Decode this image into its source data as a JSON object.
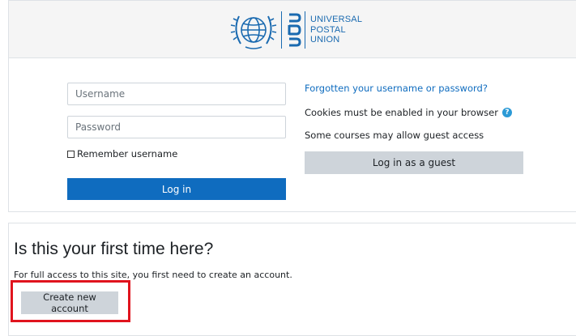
{
  "logo": {
    "abbr": "UPU",
    "lines": [
      "UNIVERSAL",
      "POSTAL",
      "UNION"
    ],
    "color": "#1a6ab0"
  },
  "login": {
    "username_placeholder": "Username",
    "password_placeholder": "Password",
    "remember_label": "Remember username",
    "login_label": "Log in",
    "forgot_link": "Forgotten your username or password?",
    "cookies_text": "Cookies must be enabled in your browser",
    "help_icon": "?",
    "guest_text": "Some courses may allow guest access",
    "guest_button": "Log in as a guest"
  },
  "first_time": {
    "title": "Is this your first time here?",
    "description": "For full access to this site, you first need to create an account.",
    "create_button": "Create new account"
  },
  "colors": {
    "primary": "#0f6cbf",
    "secondary": "#ced4da",
    "highlight": "#e0141e"
  }
}
